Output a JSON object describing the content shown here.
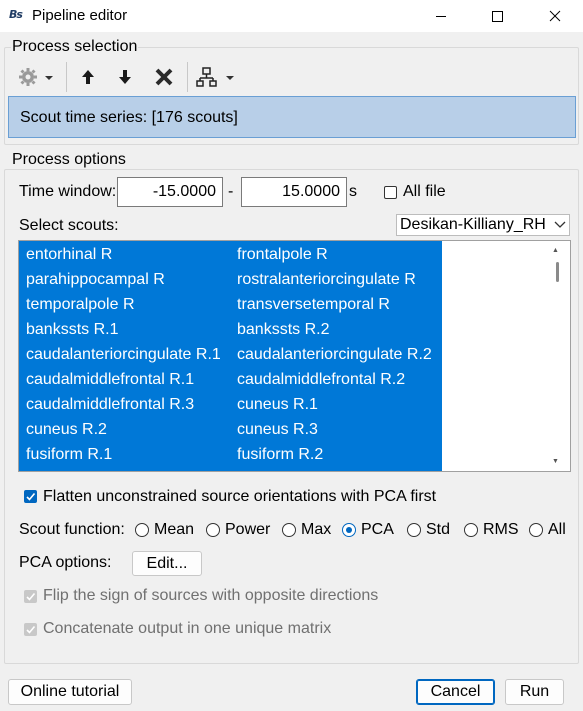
{
  "window": {
    "title": "Pipeline editor",
    "app_icon_text": "Bs"
  },
  "process_selection": {
    "group_title": "Process selection",
    "selected_process": "Scout time series: [176 scouts]"
  },
  "process_options": {
    "group_title": "Process options",
    "time_window": {
      "label": "Time window:",
      "start": "-15.0000",
      "separator": "-",
      "end": "15.0000",
      "unit": "s",
      "all_file_label": "All file",
      "all_file_checked": false
    },
    "select_scouts": {
      "label": "Select scouts:",
      "atlas": "Desikan-Killiany_RH",
      "col1": [
        "entorhinal R",
        "parahippocampal R",
        "temporalpole R",
        "bankssts R.1",
        "caudalanteriorcingulate R.1",
        "caudalmiddlefrontal R.1",
        "caudalmiddlefrontal R.3",
        "cuneus R.2",
        "fusiform R.1"
      ],
      "col2": [
        "frontalpole R",
        "rostralanteriorcingulate R",
        "transversetemporal R",
        "bankssts R.2",
        "caudalanteriorcingulate R.2",
        "caudalmiddlefrontal R.2",
        "cuneus R.1",
        "cuneus R.3",
        "fusiform R.2"
      ]
    },
    "flatten": {
      "label": "Flatten unconstrained source orientations with PCA first",
      "checked": true
    },
    "scout_function": {
      "label": "Scout function:",
      "options": [
        "Mean",
        "Power",
        "Max",
        "PCA",
        "Std",
        "RMS",
        "All"
      ],
      "selected": "PCA"
    },
    "pca_options": {
      "label": "PCA options:",
      "edit_button": "Edit..."
    },
    "flip_sign": {
      "label": "Flip the sign of sources with opposite directions",
      "checked": true,
      "enabled": false
    },
    "concatenate": {
      "label": "Concatenate output in one unique matrix",
      "checked": true,
      "enabled": false
    }
  },
  "footer": {
    "tutorial_button": "Online tutorial",
    "cancel_button": "Cancel",
    "run_button": "Run"
  }
}
